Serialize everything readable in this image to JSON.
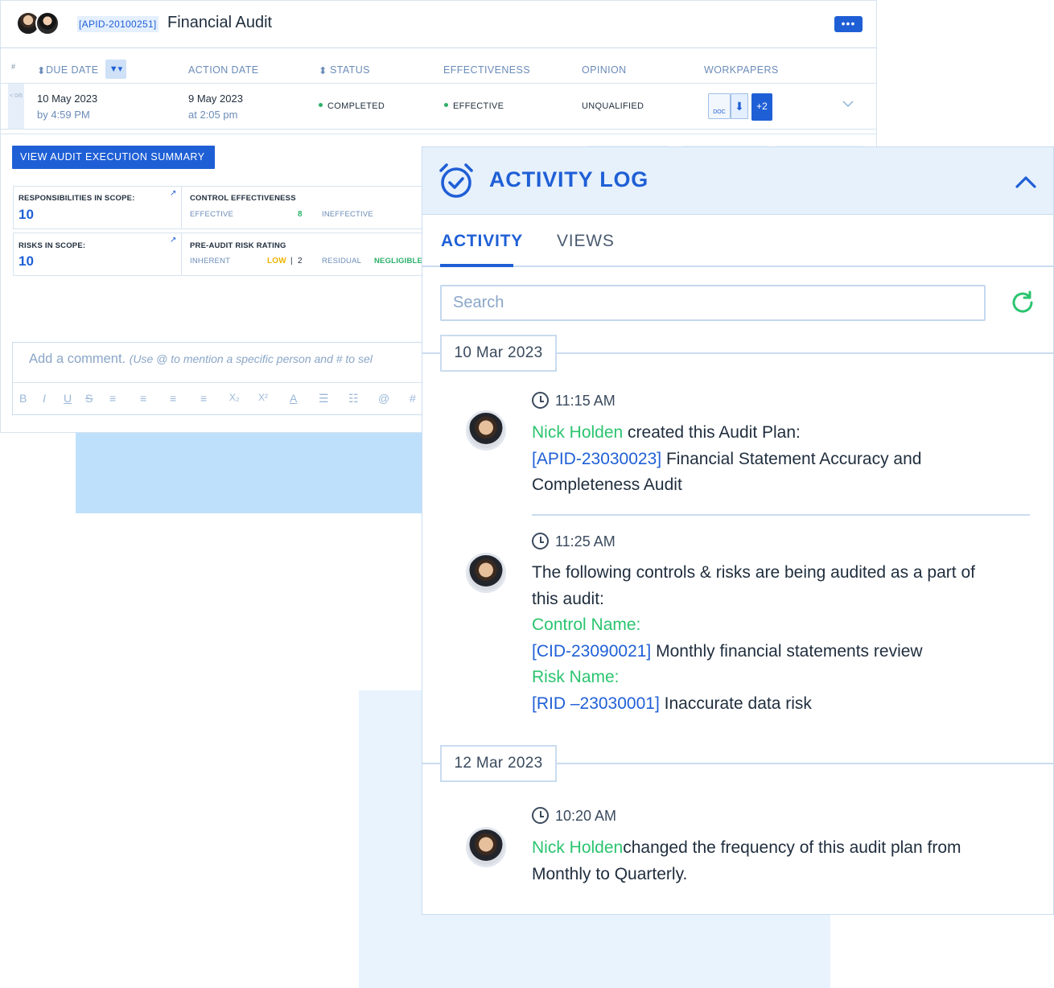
{
  "header": {
    "apid": "[APID-20100251]",
    "title": "Financial Audit",
    "more_label": "•••"
  },
  "table": {
    "hash": "#",
    "columns": {
      "due_date": "DUE DATE",
      "action_date": "ACTION DATE",
      "status": "STATUS",
      "effectiveness": "EFFECTIVENESS",
      "opinion": "OPINION",
      "workpapers": "WORKPAPERS"
    },
    "row": {
      "handle": "< 0/6",
      "due_date": "10 May 2023",
      "due_time": "by 4:59 PM",
      "action_date": "9 May 2023",
      "action_time": "at 2:05 pm",
      "status": "COMPLETED",
      "effectiveness": "EFFECTIVE",
      "opinion": "UNQUALIFIED",
      "doc_label": "DOC",
      "extra_count": "+2"
    }
  },
  "summary": {
    "button_label": "VIEW AUDIT EXECUTION SUMMARY",
    "responsibilities_label": "RESPONSIBILITIES IN SCOPE:",
    "responsibilities_value": "10",
    "risks_label": "RISKS IN SCOPE:",
    "risks_value": "10",
    "control_label": "CONTROL EFFECTIVENESS",
    "effective_label": "EFFECTIVE",
    "effective_value": "8",
    "ineffective_label": "INEFFECTIVE",
    "rating_label": "PRE-AUDIT RISK RATING",
    "inherent_label": "INHERENT",
    "inherent_level": "LOW",
    "inherent_sep": "|",
    "inherent_value": "2",
    "residual_label": "RESIDUAL",
    "residual_level": "NEGLIGIBLE"
  },
  "comment": {
    "placeholder_main": "Add a comment.",
    "placeholder_hint": "(Use @ to mention a specific person and # to sel",
    "toolbar": [
      "B",
      "I",
      "U",
      "S",
      "≡",
      "≡",
      "≡",
      "≡",
      "X₂",
      "X²",
      "A",
      "☰",
      "☷",
      "@",
      "#"
    ]
  },
  "activity_log": {
    "title": "ACTIVITY LOG",
    "tabs": [
      "ACTIVITY",
      "VIEWS"
    ],
    "search_placeholder": "Search",
    "groups": [
      {
        "date": "10 Mar 2023",
        "entries": [
          {
            "time": "11:15 AM",
            "user": "Nick Holden",
            "action": " created this Audit Plan:",
            "link_id": "[APID-23030023]",
            "link_text": " Financial Statement Accuracy and Completeness Audit"
          },
          {
            "time": "11:25 AM",
            "text": "The following controls & risks are being audited as a part of this audit:",
            "control_heading": "Control Name:",
            "control_id": "[CID-23090021]",
            "control_text": " Monthly financial statements review",
            "risk_heading": "Risk Name:",
            "risk_id": "[RID –23030001]",
            "risk_text": " Inaccurate data risk"
          }
        ]
      },
      {
        "date": "12 Mar 2023",
        "entries": [
          {
            "time": "10:20 AM",
            "user": "Nick Holden",
            "action": "changed the frequency of this audit plan from Monthly to Quarterly."
          }
        ]
      }
    ]
  },
  "colors": {
    "accent": "#1f5fd6",
    "success": "#2bc46f",
    "warning": "#f0b400",
    "panel_header_bg": "#e6f1fc",
    "border": "#c9dcef"
  }
}
